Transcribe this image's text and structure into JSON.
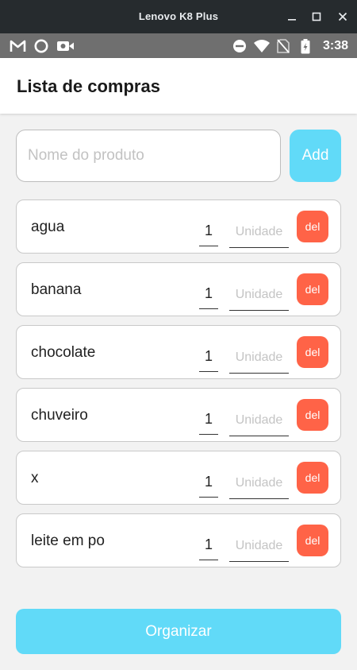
{
  "window": {
    "title": "Lenovo K8 Plus"
  },
  "status_bar": {
    "time": "3:38",
    "left_icons": [
      "gmail-icon",
      "circle-app-icon",
      "camera-icon"
    ],
    "right_icons": [
      "do-not-disturb-icon",
      "wifi-icon",
      "no-sim-icon",
      "battery-charging-icon"
    ]
  },
  "app": {
    "title": "Lista de compras"
  },
  "new_product": {
    "placeholder": "Nome do produto",
    "value": "",
    "add_label": "Add"
  },
  "items": [
    {
      "name": "agua",
      "qty": "1",
      "unit_placeholder": "Unidade",
      "del_label": "del"
    },
    {
      "name": "banana",
      "qty": "1",
      "unit_placeholder": "Unidade",
      "del_label": "del"
    },
    {
      "name": "chocolate",
      "qty": "1",
      "unit_placeholder": "Unidade",
      "del_label": "del"
    },
    {
      "name": "chuveiro",
      "qty": "1",
      "unit_placeholder": "Unidade",
      "del_label": "del"
    },
    {
      "name": "x",
      "qty": "1",
      "unit_placeholder": "Unidade",
      "del_label": "del"
    },
    {
      "name": "leite em po",
      "qty": "1",
      "unit_placeholder": "Unidade",
      "del_label": "del"
    }
  ],
  "organize_label": "Organizar",
  "colors": {
    "accent": "#61daf8",
    "delete": "#ff6347",
    "titlebar": "#262b2e",
    "statusbar": "#6f6f6f",
    "background": "#f2f2f2"
  }
}
